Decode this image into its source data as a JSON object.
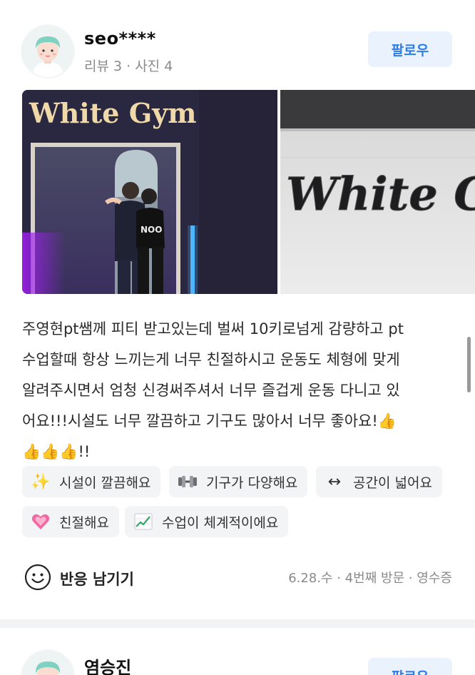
{
  "review": {
    "user": {
      "name": "seo****",
      "meta": "리뷰 3 · 사진 4"
    },
    "follow_label": "팔로우",
    "photos": [
      {
        "sign_text": "White Gym"
      },
      {
        "sign_text": "White Gy"
      }
    ],
    "text": "주영현pt쌤께 피티 받고있는데 벌써 10키로넘게 감량하고 pt\n수업할때 항상 느끼는게 너무 친절하시고 운동도 체형에 맞게\n알려주시면서 엄청 신경써주셔서 너무 즐겁게 운동 다니고 있\n어요!!!시설도 너무 깔끔하고 기구도 많아서 너무 좋아요!👍\n👍👍👍!!",
    "tags": [
      {
        "icon": "sparkles-icon",
        "glyph": "✨",
        "label": "시설이 깔끔해요"
      },
      {
        "icon": "dumbbell-icon",
        "glyph": "",
        "label": "기구가 다양해요"
      },
      {
        "icon": "left-right-arrow-icon",
        "glyph": "↔",
        "label": "공간이 넓어요"
      },
      {
        "icon": "growing-heart-icon",
        "glyph": "",
        "label": "친절해요"
      },
      {
        "icon": "chart-increasing-icon",
        "glyph": "",
        "label": "수업이 체계적이에요"
      }
    ],
    "reaction_label": "반응 남기기",
    "visit_meta": "6.28.수 · 4번째 방문 · 영수증"
  },
  "next_review": {
    "user": {
      "name": "염승진"
    },
    "follow_label": "팔로우"
  },
  "colors": {
    "accent": "#2d7ce8",
    "follow_bg": "#eaf3fd",
    "tag_bg": "#f3f4f6",
    "muted": "#8a8a8a"
  }
}
